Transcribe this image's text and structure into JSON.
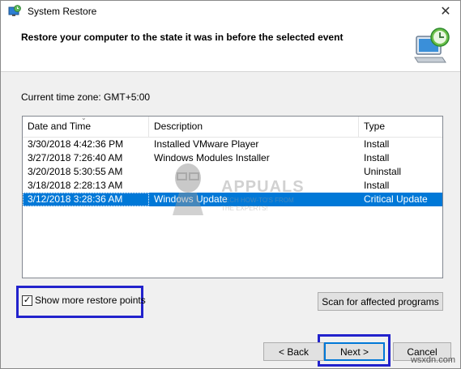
{
  "window": {
    "title": "System Restore",
    "close_glyph": "✕"
  },
  "header": {
    "title": "Restore your computer to the state it was in before the selected event",
    "icon": "system-restore-icon"
  },
  "timezone": "Current time zone: GMT+5:00",
  "list": {
    "columns": [
      "Date and Time",
      "Description",
      "Type"
    ],
    "sorted_column": "Date and Time",
    "rows": [
      {
        "date": "3/30/2018 4:42:36 PM",
        "description": "Installed VMware Player",
        "type": "Install",
        "selected": false
      },
      {
        "date": "3/27/2018 7:26:40 AM",
        "description": "Windows Modules Installer",
        "type": "Install",
        "selected": false
      },
      {
        "date": "3/20/2018 5:30:55 AM",
        "description": "",
        "type": "Uninstall",
        "selected": false
      },
      {
        "date": "3/18/2018 2:28:13 AM",
        "description": "",
        "type": "Install",
        "selected": false
      },
      {
        "date": "3/12/2018 3:28:36 AM",
        "description": "Windows Update",
        "type": "Critical Update",
        "selected": true
      }
    ]
  },
  "watermark": {
    "text": "APPUALS",
    "sub1": "TECH HOW-TO'S FROM",
    "sub2": "THE EXPERTS!"
  },
  "show_more": {
    "label": "Show more restore points",
    "checked": true
  },
  "buttons": {
    "scan": "Scan for affected programs",
    "back": "< Back",
    "next": "Next >",
    "cancel": "Cancel"
  },
  "site_watermark": "wsxdn.com",
  "colors": {
    "selection": "#0078d7",
    "highlight_box": "#2222cc"
  }
}
